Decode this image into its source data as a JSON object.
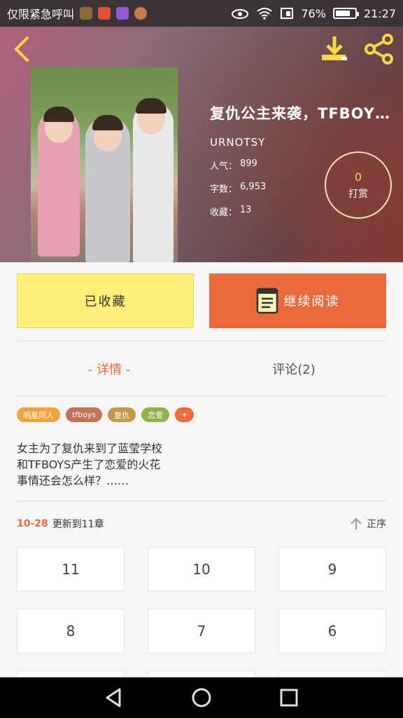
{
  "status_bar": {
    "notification_text": "仅限紧急呼叫",
    "battery": "76%",
    "battery_level": 0.76,
    "time": "21:27"
  },
  "book": {
    "title": "复仇公主来袭，TFBOY…",
    "author": "URNOTSY",
    "stats": [
      {
        "label": "人气：",
        "value": "899"
      },
      {
        "label": "字数：",
        "value": "6,953"
      },
      {
        "label": "收藏：",
        "value": "13"
      }
    ],
    "reward": {
      "count": "0",
      "label": "打赏"
    }
  },
  "actions": {
    "collected_label": "已收藏",
    "continue_label": "继续阅读"
  },
  "tabs": {
    "detail": "- 详情 -",
    "comments": "评论(2)"
  },
  "tags": [
    {
      "label": "明星同人",
      "color": "#f0a23c"
    },
    {
      "label": "tfboys",
      "color": "#c2735a"
    },
    {
      "label": "复仇",
      "color": "#c39a4a"
    },
    {
      "label": "恋爱",
      "color": "#8fb04a"
    },
    {
      "label": "+",
      "color": "#ef6a3c"
    }
  ],
  "description": [
    "女主为了复仇来到了蓝莹学校",
    "和TFBOYS产生了恋爱的火花",
    "事情还会怎么样？……"
  ],
  "update": {
    "date": "10-28",
    "text": "更新到11章",
    "sort_label": "正序"
  },
  "chapters": [
    "11",
    "10",
    "9",
    "8",
    "7",
    "6"
  ],
  "colors": {
    "accent": "#e8693b",
    "collected_bg": "#fbf07a"
  }
}
